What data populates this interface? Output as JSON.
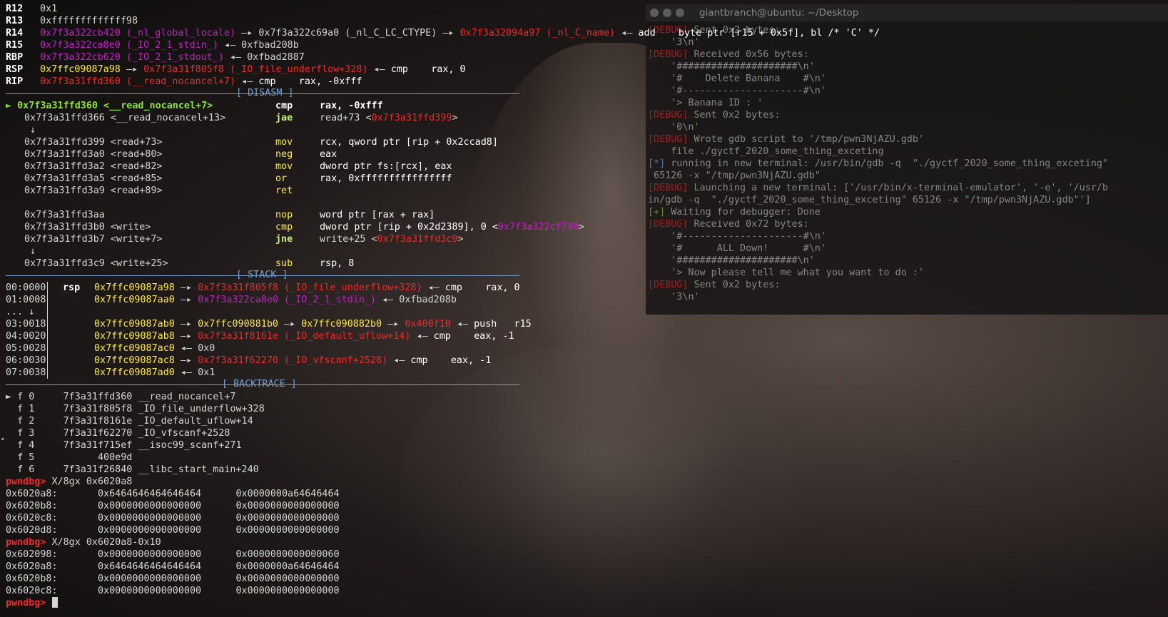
{
  "window_title": "giantbranch@ubuntu: ~/Desktop",
  "registers": [
    {
      "name": "R12",
      "value": "0x1"
    },
    {
      "name": "R13",
      "value": "0xfffffffffffff98"
    },
    {
      "name": "R14",
      "a1": "0x7f3a322cb420 (_nl_global_locale)",
      "a2": "0x7f3a322c69a0 (_nl_C_LC_CTYPE)",
      "a3": "0x7f3a32094a97 (_nl_C_name)",
      "a4": "add    byte ptr [r15 + 0x5f], bl /* 'C' */"
    },
    {
      "name": "R15",
      "a1": "0x7f3a322ca8e0 (_IO_2_1_stdin_)",
      "a2": "0xfbad208b"
    },
    {
      "name": "RBP",
      "a1": "0x7f3a322cb620 (_IO_2_1_stdout_)",
      "a2": "0xfbad2887"
    },
    {
      "name": "RSP",
      "a1": "0x7ffc09087a98",
      "a2": "0x7f3a31f805f8 (_IO_file_underflow+328)",
      "a3": "cmp    rax, 0"
    },
    {
      "name": "RIP",
      "a1": "0x7f3a31ffd360 (__read_nocancel+7)",
      "a2": "cmp    rax, -0xfff"
    }
  ],
  "arrow": "—▸",
  "larrow": "◂—",
  "disasm_title": "[ DISASM ]",
  "disasm": {
    "l0": {
      "addr": "► 0x7f3a31ffd360 <__read_nocancel+7>",
      "op": "cmp",
      "args": "rax, -0xfff"
    },
    "l1": {
      "addr": "0x7f3a31ffd366 <__read_nocancel+13>",
      "op": "jae",
      "args": "read+73 <",
      "tgt": "0x7f3a31ffd399",
      ">": ">"
    },
    "d1": "↓",
    "l2": {
      "addr": "0x7f3a31ffd399 <read+73>",
      "op": "mov",
      "args": "rcx, qword ptr [rip + 0x2ccad8]"
    },
    "l3": {
      "addr": "0x7f3a31ffd3a0 <read+80>",
      "op": "neg",
      "args": "eax"
    },
    "l4": {
      "addr": "0x7f3a31ffd3a2 <read+82>",
      "op": "mov",
      "args": "dword ptr fs:[rcx], eax"
    },
    "l5": {
      "addr": "0x7f3a31ffd3a5 <read+85>",
      "op": "or",
      "args": "rax, 0xffffffffffffffff"
    },
    "l6": {
      "addr": "0x7f3a31ffd3a9 <read+89>",
      "op": "ret",
      "args": ""
    },
    "l7": {
      "addr": "0x7f3a31ffd3aa",
      "op": "nop",
      "args": "word ptr [rax + rax]"
    },
    "l8": {
      "addr": "0x7f3a31ffd3b0 <write>",
      "op": "cmp",
      "args": "dword ptr [rip + 0x2d2389], 0 <",
      "tgt": "0x7f3a322cf740",
      ">": ">"
    },
    "l9": {
      "addr": "0x7f3a31ffd3b7 <write+7>",
      "op": "jne",
      "args": "write+25 <",
      "tgt": "0x7f3a31ffd3c9",
      ">": ">"
    },
    "d2": "↓",
    "l10": {
      "addr": "0x7f3a31ffd3c9 <write+25>",
      "op": "sub",
      "args": "rsp, 8"
    }
  },
  "stack_title": "[ STACK ]",
  "stack": {
    "s0": {
      "off": "00:0000",
      "reg": "rsp",
      "addr": "0x7ffc09087a98",
      "v1": "0x7f3a31f805f8 (_IO_file_underflow+328)",
      "ins": "cmp    rax, 0"
    },
    "s1": {
      "off": "01:0008",
      "addr": "0x7ffc09087aa0",
      "v1": "0x7f3a322ca8e0 (_IO_2_1_stdin_)",
      "v2": "0xfbad208b"
    },
    "dots": "... ↓",
    "s3": {
      "off": "03:0018",
      "addr": "0x7ffc09087ab0",
      "v1": "0x7ffc090881b0",
      "v2": "0x7ffc090882b0",
      "v3": "0x400f10",
      "ins": "push   r15"
    },
    "s4": {
      "off": "04:0020",
      "addr": "0x7ffc09087ab8",
      "v1": "0x7f3a31f8161e (_IO_default_uflow+14)",
      "ins": "cmp    eax, -1"
    },
    "s5": {
      "off": "05:0028",
      "addr": "0x7ffc09087ac0",
      "v1": "0x0"
    },
    "s6": {
      "off": "06:0030",
      "addr": "0x7ffc09087ac8",
      "v1": "0x7f3a31f62270 (_IO_vfscanf+2528)",
      "ins": "cmp    eax, -1"
    },
    "s7": {
      "off": "07:0038",
      "addr": "0x7ffc09087ad0",
      "v1": "0x1"
    }
  },
  "backtrace_title": "[ BACKTRACE ]",
  "backtrace": [
    "► f 0     7f3a31ffd360 __read_nocancel+7",
    "  f 1     7f3a31f805f8 _IO_file_underflow+328",
    "  f 2     7f3a31f8161e _IO_default_uflow+14",
    "  f 3     7f3a31f62270 _IO_vfscanf+2528",
    "  f 4     7f3a31f715ef __isoc99_scanf+271",
    "  f 5           400e9d",
    "  f 6     7f3a31f26840 __libc_start_main+240"
  ],
  "prompt": "pwndbg>",
  "cmd1": " X/8gx 0x6020a8",
  "mem1": [
    "0x6020a8:       0x6464646464646464      0x0000000a64646464",
    "0x6020b8:       0x0000000000000000      0x0000000000000000",
    "0x6020c8:       0x0000000000000000      0x0000000000000000",
    "0x6020d8:       0x0000000000000000      0x0000000000000000"
  ],
  "cmd2": " X/8gx 0x6020a8-0x10",
  "mem2": [
    "0x602098:       0x0000000000000000      0x0000000000000060",
    "0x6020a8:       0x6464646464646464      0x0000000a64646464",
    "0x6020b8:       0x0000000000000000      0x0000000000000000",
    "0x6020c8:       0x0000000000000000      0x0000000000000000"
  ],
  "term_lines": {
    "t0": {
      "tag": "[DEBUG]",
      "text": " Sent 0x2 bytes:"
    },
    "t1": {
      "text": "    '3\\n'"
    },
    "t2": {
      "tag": "[DEBUG]",
      "text": " Received 0x56 bytes:"
    },
    "t3": {
      "text": "    '#####################\\n'"
    },
    "t4": {
      "text": "    '#    Delete Banana    #\\n'"
    },
    "t5": {
      "text": "    '#---------------------#\\n'"
    },
    "t6": {
      "text": "    '> Banana ID : '"
    },
    "t7": {
      "tag": "[DEBUG]",
      "text": " Sent 0x2 bytes:"
    },
    "t8": {
      "text": "    '0\\n'"
    },
    "t9": {
      "tag": "[DEBUG]",
      "text": " Wrote gdb script to '/tmp/pwn3NjAZU.gdb'"
    },
    "t10": {
      "text": "    file ./gyctf_2020_some_thing_exceting"
    },
    "t11": {
      "tag": "[*]",
      "text": " running in new terminal: /usr/bin/gdb -q  \"./gyctf_2020_some_thing_exceting\""
    },
    "t12": {
      "text": " 65126 -x \"/tmp/pwn3NjAZU.gdb\""
    },
    "t13": {
      "tag": "[DEBUG]",
      "text": " Launching a new terminal: ['/usr/bin/x-terminal-emulator', '-e', '/usr/b"
    },
    "t14": {
      "text": "in/gdb -q  \"./gyctf_2020_some_thing_exceting\" 65126 -x \"/tmp/pwn3NjAZU.gdb\"']"
    },
    "t15": {
      "tag": "[+]",
      "text": " Waiting for debugger: Done"
    },
    "t16": {
      "tag": "[DEBUG]",
      "text": " Received 0x72 bytes:"
    },
    "t17": {
      "text": "    '#---------------------#\\n'"
    },
    "t18": {
      "text": "    '#      ALL Down!      #\\n'"
    },
    "t19": {
      "text": "    '#####################\\n'"
    },
    "t20": {
      "text": "    '> Now please tell me what you want to do :'"
    },
    "t21": {
      "tag": "[DEBUG]",
      "text": " Sent 0x2 bytes:"
    },
    "t22": {
      "text": "    '3\\n'"
    }
  }
}
